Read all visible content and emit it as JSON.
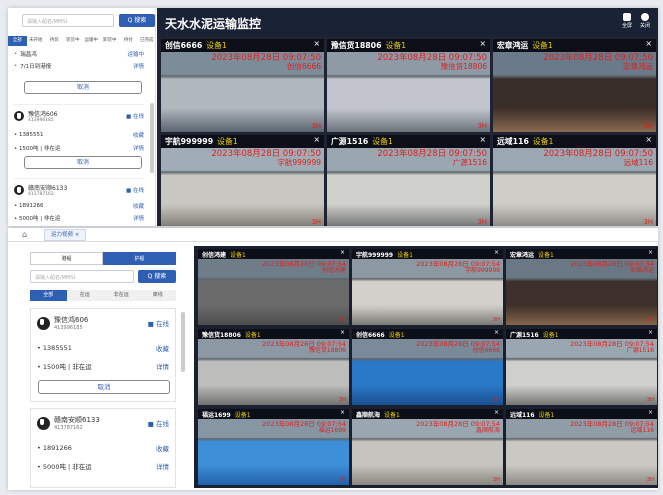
{
  "top": {
    "title": "天水水泥运输监控",
    "search_placeholder": "请输入船名/MMSI",
    "search_btn": "Q 搜索",
    "tabs": [
      "全部",
      "未开始",
      "待装",
      "装货中",
      "运输中",
      "卸货中",
      "待付",
      "已完成"
    ],
    "cards": [
      {
        "name": "瑞昌鸿",
        "status": "运输中",
        "detail": "7/1日到港报",
        "detail_link": "详情"
      },
      {
        "name": "豫信鸿606",
        "mmsi": "413996185",
        "online": "在线",
        "phone": "1385551",
        "phone_action": "收藏",
        "load": "1500吨 | 非在运",
        "load_action": "详情",
        "cancel": "取消"
      },
      {
        "name": "赣南安顺6133",
        "mmsi": "413787162",
        "online": "在线",
        "phone": "1891266",
        "phone_action": "收藏",
        "load": "5000吨 | 非在运",
        "load_action": "详情"
      }
    ],
    "header_icons": [
      {
        "icon": "fullscreen-icon",
        "label": "全屏"
      },
      {
        "icon": "close-icon",
        "label": "关闭"
      }
    ],
    "cams": [
      {
        "name": "创信6666",
        "device": "设备1",
        "ts": "2023年08月28日 09:07:50",
        "tag": "创信6666",
        "res": "3H"
      },
      {
        "name": "豫信货18806",
        "device": "设备1",
        "ts": "2023年08月28日 09:07:50",
        "tag": "豫信货18806",
        "res": "3H"
      },
      {
        "name": "宏章鸿运",
        "device": "设备1",
        "ts": "2023年08月28日 09:07:50",
        "tag": "宏章鸿运",
        "res": "3H"
      },
      {
        "name": "宇航999999",
        "device": "设备1",
        "ts": "2023年08月28日 09:07:50",
        "tag": "宇航999999",
        "res": "3H"
      },
      {
        "name": "广源1516",
        "device": "设备1",
        "ts": "2023年08月28日 09:07:50",
        "tag": "广源1516",
        "res": "3H"
      },
      {
        "name": "远域116",
        "device": "设备1",
        "ts": "2023年08月28日 09:07:50",
        "tag": "远域116",
        "res": "3H"
      }
    ]
  },
  "bot": {
    "tab": "运力视频",
    "seg": [
      "港船",
      "护船"
    ],
    "search_placeholder": "请输入船名/MMSI",
    "search_btn": "Q 搜索",
    "tabs": [
      "全部",
      "在运",
      "非在运",
      "离线"
    ],
    "cards": [
      {
        "name": "豫信鸿606",
        "mmsi": "413996185",
        "online": "在线",
        "phone": "1385551",
        "phone_action": "收藏",
        "load": "1500吨 | 非在运",
        "load_action": "详情",
        "cancel": "取消"
      },
      {
        "name": "赣南安顺6133",
        "mmsi": "413787162",
        "online": "在线",
        "phone": "1891266",
        "phone_action": "收藏",
        "load": "5000吨 | 非在运",
        "load_action": "详情"
      }
    ],
    "cams": [
      {
        "name": "创信鸿建",
        "device": "设备1",
        "ts": "2023年08月28日 09:07:54",
        "tag": "创信鸿建",
        "res": "3H"
      },
      {
        "name": "宇航999999",
        "device": "设备1",
        "ts": "2023年08月28日 09:07:54",
        "tag": "宇航999999",
        "res": "3H"
      },
      {
        "name": "宏章鸿运",
        "device": "设备1",
        "ts": "2023年08月28日 09:07:54",
        "tag": "宏章鸿运",
        "res": "3H"
      },
      {
        "name": "豫信货18806",
        "device": "设备1",
        "ts": "2023年08月28日 09:07:54",
        "tag": "豫信货18806",
        "res": "3H"
      },
      {
        "name": "创信6666",
        "device": "设备1",
        "ts": "2023年08月28日 09:07:54",
        "tag": "创信6666",
        "res": "3H"
      },
      {
        "name": "广源1516",
        "device": "设备1",
        "ts": "2023年08月28日 09:07:54",
        "tag": "广源1516",
        "res": "3H"
      },
      {
        "name": "福运1699",
        "device": "设备1",
        "ts": "2023年08月28日 09:07:54",
        "tag": "福运1699",
        "res": "3H"
      },
      {
        "name": "鑫顺航海",
        "device": "设备1",
        "ts": "2023年08月28日 09:07:54",
        "tag": "鑫顺航海",
        "res": "3H"
      },
      {
        "name": "远域116",
        "device": "设备1",
        "ts": "2023年08月28日 09:07:54",
        "tag": "远域116",
        "res": "3H"
      }
    ]
  },
  "colors": {
    "accent": "#2f5fb3",
    "dark": "#1e2434",
    "ts_red": "#e02020",
    "device_yellow": "#f0d000"
  }
}
